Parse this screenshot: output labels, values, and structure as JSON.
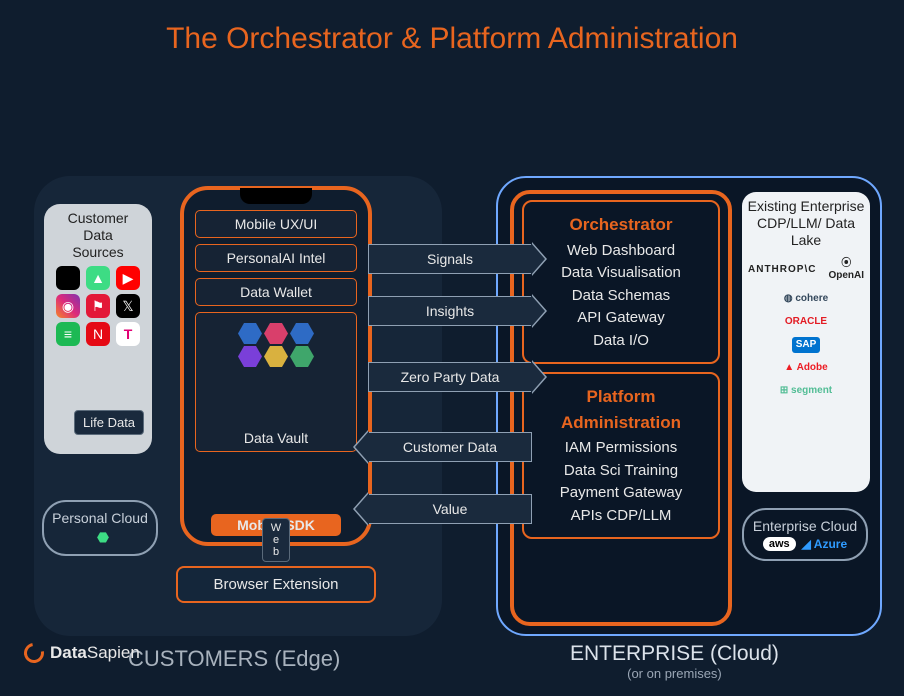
{
  "title": "The Orchestrator & Platform Administration",
  "customers": {
    "label": "CUSTOMERS (Edge)",
    "data_sources_title": "Customer\nData\nSources",
    "life_data": "Life Data",
    "phone": {
      "mobile_ux": "Mobile UX/UI",
      "personal_ai": "PersonalAI Intel",
      "data_wallet": "Data Wallet",
      "data_vault": "Data Vault",
      "sdk": "Mobile SDK",
      "web": "W\ne\nb"
    },
    "browser_ext": "Browser  Extension",
    "personal_cloud": "Personal Cloud"
  },
  "flows": {
    "signals": "Signals",
    "insights": "Insights",
    "zpd": "Zero Party Data",
    "customer_data": "Customer Data",
    "value": "Value"
  },
  "enterprise": {
    "label": "ENTERPRISE (Cloud)",
    "sublabel": "(or on premises)",
    "orchestrator": {
      "title": "Orchestrator",
      "lines": "Web Dashboard\nData Visualisation\nData Schemas\nAPI Gateway\nData I/O"
    },
    "platform_admin": {
      "title": "Platform Administration",
      "lines": "IAM Permissions\nData Sci Training\nPayment Gateway\nAPIs CDP/LLM"
    },
    "existing": "Existing Enterprise CDP/LLM/ Data Lake",
    "enterprise_cloud": "Enterprise Cloud",
    "partners": {
      "anthropic": "ANTHROP\\C",
      "openai": "OpenAI",
      "cohere": "cohere",
      "oracle": "ORACLE",
      "sap": "SAP",
      "adobe": "Adobe",
      "segment": "segment"
    }
  },
  "footer": {
    "brand_bold": "Data",
    "brand_light": "Sapien"
  }
}
